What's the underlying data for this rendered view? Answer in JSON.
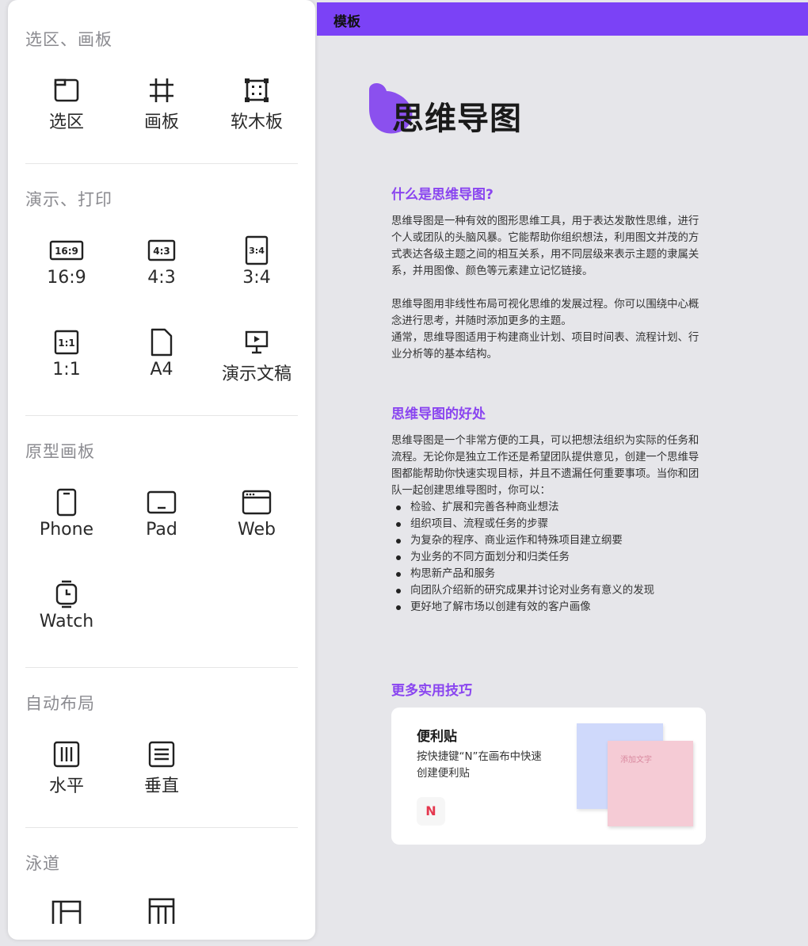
{
  "sidebar": {
    "sections": [
      {
        "title": "选区、画板",
        "tools": [
          {
            "label": "选区",
            "icon": "select-frame-icon"
          },
          {
            "label": "画板",
            "icon": "artboard-icon"
          },
          {
            "label": "软木板",
            "icon": "corkboard-icon"
          }
        ]
      },
      {
        "title": "演示、打印",
        "tools": [
          {
            "label": "16:9",
            "icon": "ratio-16-9-icon"
          },
          {
            "label": "4:3",
            "icon": "ratio-4-3-icon"
          },
          {
            "label": "3:4",
            "icon": "ratio-3-4-icon"
          },
          {
            "label": "1:1",
            "icon": "ratio-1-1-icon"
          },
          {
            "label": "A4",
            "icon": "page-a4-icon"
          },
          {
            "label": "演示文稿",
            "icon": "presentation-icon"
          }
        ]
      },
      {
        "title": "原型画板",
        "tools": [
          {
            "label": "Phone",
            "icon": "phone-icon"
          },
          {
            "label": "Pad",
            "icon": "tablet-icon"
          },
          {
            "label": "Web",
            "icon": "browser-window-icon"
          },
          {
            "label": "Watch",
            "icon": "watch-icon"
          }
        ]
      },
      {
        "title": "自动布局",
        "tools": [
          {
            "label": "水平",
            "icon": "horizontal-layout-icon"
          },
          {
            "label": "垂直",
            "icon": "vertical-layout-icon"
          }
        ]
      },
      {
        "title": "泳道",
        "tools": [
          {
            "label": "",
            "icon": "swimlane-horizontal-icon"
          },
          {
            "label": "",
            "icon": "swimlane-vertical-icon"
          }
        ]
      }
    ],
    "ratio_icon_text": {
      "r169": "16:9",
      "r43": "4:3",
      "r34": "3:4",
      "r11": "1:1"
    }
  },
  "topbar": {
    "title": "模板",
    "color": "#7b42f6"
  },
  "doc": {
    "title": "思维导图",
    "accent": "#8a45f0",
    "s1_heading": "什么是思维导图?",
    "s1_p1": "思维导图是一种有效的图形思维工具，用于表达发散性思维，进行个人或团队的头脑风暴。它能帮助你组织想法，利用图文并茂的方式表达各级主题之间的相互关系，用不同层级来表示主题的隶属关系，并用图像、颜色等元素建立记忆链接。",
    "s1_p2": "思维导图用非线性布局可视化思维的发展过程。你可以围绕中心概念进行思考，并随时添加更多的主题。",
    "s1_p3": "通常，思维导图适用于构建商业计划、项目时间表、流程计划、行业分析等的基本结构。",
    "s2_heading": "思维导图的好处",
    "s2_p1": "思维导图是一个非常方便的工具，可以把想法组织为实际的任务和流程。无论你是独立工作还是希望团队提供意见，创建一个思维导图都能帮助你快速实现目标，并且不遗漏任何重要事项。当你和团队一起创建思维导图时，你可以：",
    "s2_bullets": [
      "检验、扩展和完善各种商业想法",
      "组织项目、流程或任务的步骤",
      "为复杂的程序、商业运作和特殊项目建立纲要",
      "为业务的不同方面划分和归类任务",
      "构思新产品和服务",
      "向团队介绍新的研究成果并讨论对业务有意义的发现",
      "更好地了解市场以创建有效的客户画像"
    ],
    "s3_heading": "更多实用技巧",
    "card": {
      "title": "便利贴",
      "desc": "按快捷键“N”在画布中快速创建便利贴",
      "key": "N",
      "note_text": "添加文字"
    }
  }
}
